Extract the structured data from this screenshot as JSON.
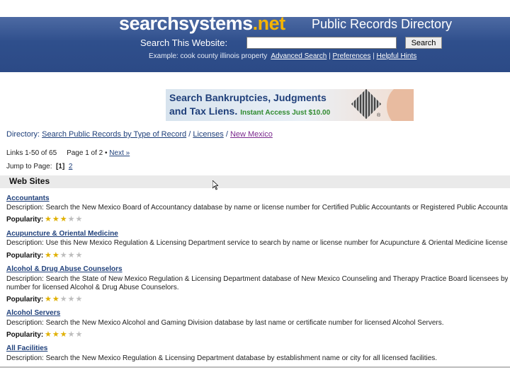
{
  "header": {
    "logo_main": "searchsystems",
    "logo_tld": ".net",
    "directory_title": "Public Records Directory",
    "search_label": "Search This Website:",
    "search_value": "",
    "search_button": "Search",
    "example_text": "Example: cook county illinois property",
    "advanced_search": "Advanced Search",
    "preferences": "Preferences",
    "helpful_hints": "Helpful Hints",
    "sep": "|",
    "colors": {
      "header_bg": "#2f4f8c",
      "tld_accent": "#f5b400"
    }
  },
  "ad": {
    "line1": "Search Bankruptcies, Judgments",
    "line2": "and Tax Liens.",
    "offer": "Instant Access Just $10.00"
  },
  "breadcrumb": {
    "prefix": "Directory:",
    "crumbs": [
      "Search Public Records by Type of Record",
      "Licenses",
      "New Mexico"
    ],
    "sep": "/"
  },
  "pagination": {
    "links_info": "Links 1-50 of 65",
    "page_info": "Page 1 of 2 •",
    "next_label": "Next »",
    "jump_label": "Jump to Page:",
    "current_page": "[1]",
    "other_page": "2"
  },
  "section": {
    "title": "Web Sites"
  },
  "entries": [
    {
      "title": "Accountants",
      "description": "Description: Search the New Mexico Board of Accountancy database by name or license number for Certified Public Accountants or Registered Public Accountants.",
      "popularity_label": "Popularity:",
      "rating": 3,
      "max_rating": 5
    },
    {
      "title": "Acupuncture & Oriental Medicine",
      "description": "Description: Use this New Mexico Regulation & Licensing Department service to search by name or license number for Acupuncture & Oriental Medicine licensees.",
      "popularity_label": "Popularity:",
      "rating": 2,
      "max_rating": 5
    },
    {
      "title": "Alcohol & Drug Abuse Counselors",
      "description": "Description: Search the State of New Mexico Regulation & Licensing Department database of New Mexico Counseling and Therapy Practice Board licensees by name or license",
      "description2": "number for licensed Alcohol & Drug Abuse Counselors.",
      "popularity_label": "Popularity:",
      "rating": 2,
      "max_rating": 5
    },
    {
      "title": "Alcohol Servers",
      "description": "Description: Search the New Mexico Alcohol and Gaming Division database by last name or certificate number for licensed Alcohol Servers.",
      "popularity_label": "Popularity:",
      "rating": 3,
      "max_rating": 5
    },
    {
      "title": "All Facilities",
      "description": "Description: Search the New Mexico Regulation & Licensing Department database by establishment name or city for all licensed facilities."
    }
  ]
}
